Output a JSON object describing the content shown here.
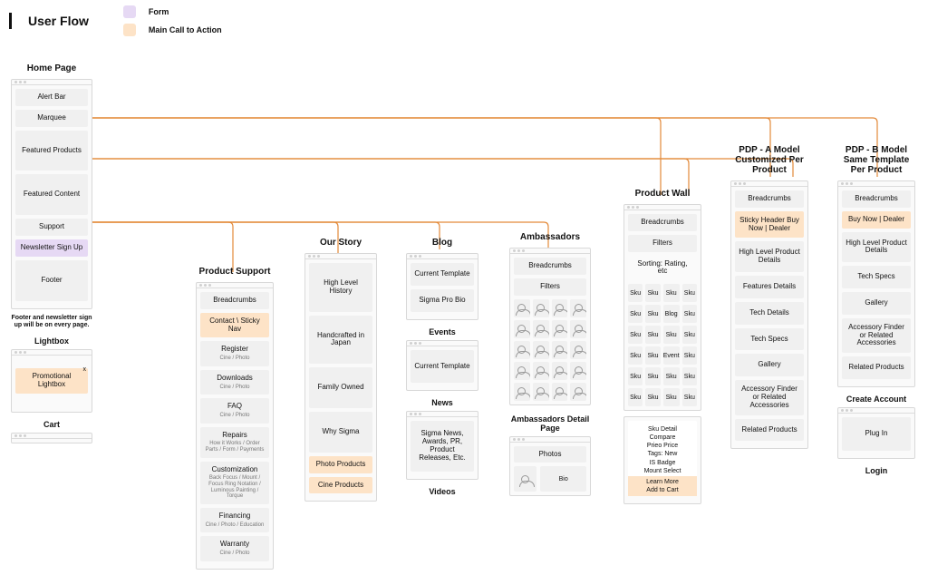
{
  "title": "User Flow",
  "legend": {
    "form": "Form",
    "cta": "Main Call to Action"
  },
  "home": {
    "heading": "Home Page",
    "items": [
      "Alert Bar",
      "Marquee",
      "Featured Products",
      "Featured Content",
      "Support",
      "Newsletter Sign Up",
      "Footer"
    ],
    "note": "Footer and newsletter sign up will be on every page."
  },
  "lightbox": {
    "heading": "Lightbox",
    "item": "Promotional Lightbox"
  },
  "cart": {
    "heading": "Cart"
  },
  "support_col": {
    "heading": "Product Support",
    "crumbs": "Breadcrumbs",
    "sticky": "Contact \\ Sticky Nav",
    "register": "Register",
    "register_sub": "Cine / Photo",
    "downloads": "Downloads",
    "downloads_sub": "Cine / Photo",
    "faq": "FAQ",
    "faq_sub": "Cine / Photo",
    "repairs": "Repairs",
    "repairs_sub": "How it Works / Order Parts / Form / Payments",
    "custom": "Customization",
    "custom_sub": "Back Focus / Mount / Focus Ring Notation / Luminous Painting / Torque",
    "financing": "Financing",
    "financing_sub": "Cine / Photo / Education",
    "warranty": "Warranty",
    "warranty_sub": "Cine / Photo"
  },
  "story": {
    "heading": "Our Story",
    "items": [
      "High Level History",
      "Handcrafted in Japan",
      "Family Owned",
      "Why Sigma"
    ],
    "cta": [
      "Photo Products",
      "Cine Products"
    ]
  },
  "blog": {
    "heading": "Blog",
    "items": [
      "Current Template",
      "Sigma Pro Bio"
    ]
  },
  "events": {
    "heading": "Events",
    "items": [
      "Current Template"
    ]
  },
  "news": {
    "heading": "News",
    "items": [
      "Sigma News, Awards, PR, Product Releases, Etc."
    ]
  },
  "videos": {
    "heading": "Videos"
  },
  "amb": {
    "heading": "Ambassadors",
    "crumbs": "Breadcrumbs",
    "filters": "Filters"
  },
  "amb_detail": {
    "heading": "Ambassadors Detail Page",
    "photos": "Photos",
    "bio": "Bio"
  },
  "wall": {
    "heading": "Product Wall",
    "crumbs": "Breadcrumbs",
    "filters": "Filters",
    "sort": "Sorting: Rating, etc",
    "sku": "Sku",
    "blog": "Blog",
    "event": "Event"
  },
  "skupop": {
    "lines": [
      "Sku Detail",
      "Compare",
      "Prieo Price",
      "Tags: New",
      "IS Badge",
      "Mount Select"
    ],
    "cta": [
      "Learn More",
      "Add to Cart"
    ]
  },
  "pdpA": {
    "heading": "PDP - A Model Customized Per Product",
    "items": [
      "Breadcrumbs",
      "Sticky Header Buy Now | Dealer",
      "High Level Product Details",
      "Features Details",
      "Tech Details",
      "Tech Specs",
      "Gallery",
      "Accessory Finder or Related Accessories",
      "Related Products"
    ]
  },
  "pdpB": {
    "heading": "PDP - B Model Same Template Per Product",
    "items": [
      "Breadcrumbs",
      "Buy Now | Dealer",
      "High Level Product Details",
      "Tech Specs",
      "Gallery",
      "Accessory Finder or Related Accessories",
      "Related Products"
    ]
  },
  "create": {
    "heading": "Create Account",
    "item": "Plug In"
  },
  "login": {
    "heading": "Login"
  }
}
